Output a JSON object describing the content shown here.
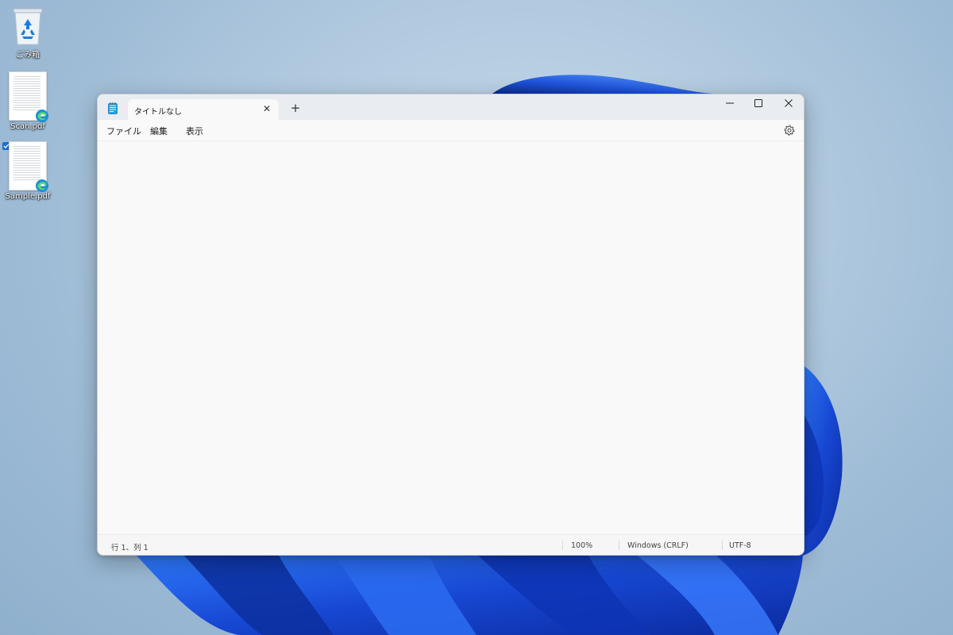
{
  "desktop": {
    "icons": [
      {
        "label": "ごみ箱",
        "icon": "recycle-bin-icon"
      },
      {
        "label": "Scan.pdf",
        "icon": "pdf-file-icon"
      },
      {
        "label": "Sample.pdf",
        "icon": "pdf-file-icon",
        "selected": true
      }
    ]
  },
  "window": {
    "app_icon": "notepad-icon",
    "tab": {
      "title": "タイトルなし",
      "close_label": "✕"
    },
    "new_tab_label": "+",
    "controls": {
      "minimize": "minimize-icon",
      "maximize": "maximize-icon",
      "close": "close-icon"
    },
    "menu": {
      "file": "ファイル",
      "edit": "編集",
      "view": "表示",
      "settings_icon": "gear-icon"
    },
    "editor": {
      "content": ""
    },
    "status": {
      "position": "行 1、列 1",
      "zoom": "100%",
      "line_ending": "Windows (CRLF)",
      "encoding": "UTF-8"
    }
  },
  "colors": {
    "accent": "#1f6fd0",
    "wallpaper_bloom": "#1a4fd6",
    "window_bg": "#f9f9f9",
    "titlebar_bg": "#e9ecf0"
  }
}
